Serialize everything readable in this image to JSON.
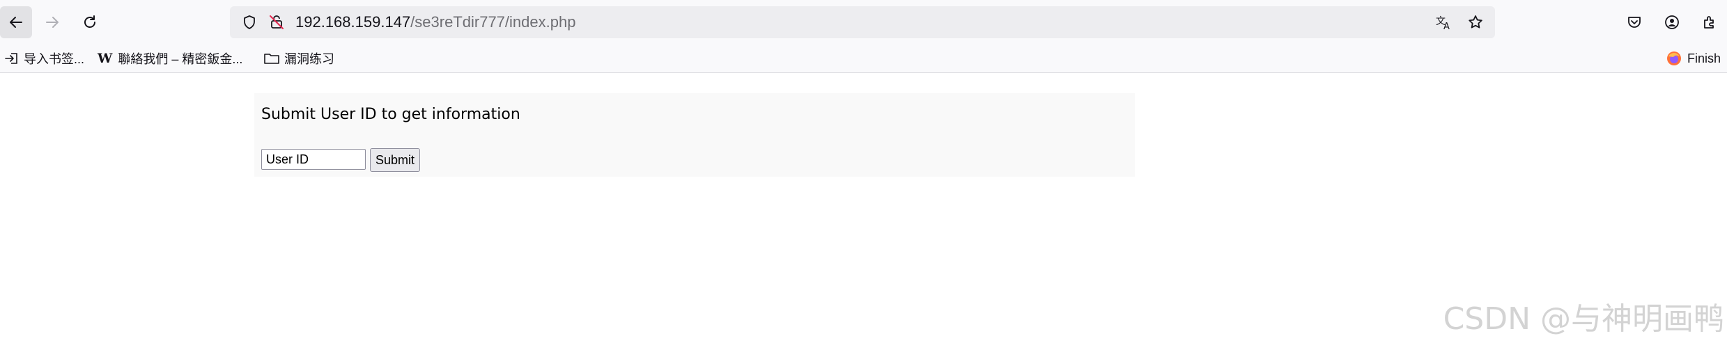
{
  "browser": {
    "url_host": "192.168.159.147",
    "url_path": "/se3reTdir777/index.php",
    "nav": {
      "back_icon": "arrow-left-icon",
      "forward_icon": "arrow-right-icon",
      "reload_icon": "reload-icon"
    },
    "toolbar_icons": [
      "pocket-icon",
      "account-icon",
      "extensions-icon"
    ],
    "accent_color": "#15141a"
  },
  "bookmarks": [
    {
      "label": "导入书签...",
      "icon": "import-icon"
    },
    {
      "label": "聯絡我們 – 精密鈑金...",
      "icon": "w-site-icon",
      "mark": "W"
    },
    {
      "label": "漏洞练习",
      "icon": "folder-icon"
    }
  ],
  "bookmarks_right": {
    "label": "Finish",
    "icon": "firefox-icon"
  },
  "page": {
    "heading": "Submit User ID to get information",
    "input_placeholder": "User ID",
    "submit_label": "Submit"
  },
  "watermark": "CSDN @与神明画鸭"
}
